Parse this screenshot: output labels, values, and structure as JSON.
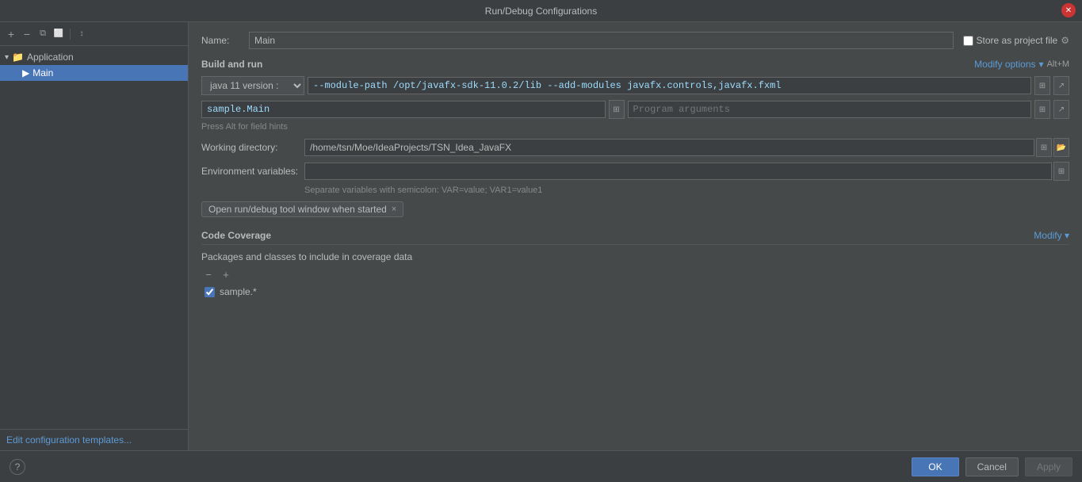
{
  "titlebar": {
    "title": "Run/Debug Configurations"
  },
  "sidebar": {
    "toolbar": {
      "add_icon": "+",
      "remove_icon": "−",
      "copy_icon": "⧉",
      "move_up_icon": "▲",
      "sort_icon": "⇅"
    },
    "tree": {
      "group_label": "Application",
      "group_arrow": "▾",
      "selected_item": "Main"
    },
    "footer_link": "Edit configuration templates..."
  },
  "content": {
    "name_label": "Name:",
    "name_value": "Main",
    "store_project_label": "Store as project file",
    "store_gear": "⚙",
    "build_run_title": "Build and run",
    "modify_options_label": "Modify options",
    "modify_options_arrow": "▾",
    "shortcut": "Alt+M",
    "java_version": "java 11 version :",
    "vm_options": "--module-path /opt/javafx-sdk-11.0.2/lib --add-modules javafx.controls,javafx.fxml",
    "main_class": "sample.Main",
    "program_args_placeholder": "Program arguments",
    "hint_text": "Press Alt for field hints",
    "working_directory_label": "Working directory:",
    "working_directory_value": "/home/tsn/Moe/IdeaProjects/TSN_Idea_JavaFX",
    "env_variables_label": "Environment variables:",
    "env_hint": "Separate variables with semicolon: VAR=value; VAR1=value1",
    "tag_label": "Open run/debug tool window when started",
    "tag_close": "×",
    "code_coverage_title": "Code Coverage",
    "coverage_modify_label": "Modify",
    "coverage_modify_arrow": "▾",
    "coverage_desc": "Packages and classes to include in coverage data",
    "coverage_remove_icon": "−",
    "coverage_add_icon": "+",
    "coverage_item_checked": true,
    "coverage_item_label": "sample.*"
  },
  "bottom": {
    "help_icon": "?",
    "ok_label": "OK",
    "cancel_label": "Cancel",
    "apply_label": "Apply"
  }
}
